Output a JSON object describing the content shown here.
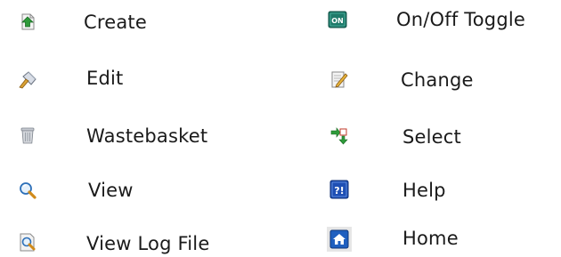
{
  "legend": {
    "left": [
      {
        "label": "Create",
        "icon": "create-icon"
      },
      {
        "label": "Edit",
        "icon": "edit-icon"
      },
      {
        "label": "Wastebasket",
        "icon": "wastebasket-icon"
      },
      {
        "label": "View",
        "icon": "view-icon"
      },
      {
        "label": "View Log File",
        "icon": "view-log-file-icon"
      }
    ],
    "right": [
      {
        "label": "On/Off Toggle",
        "icon": "on-off-toggle-icon",
        "icon_text": "ON"
      },
      {
        "label": "Change",
        "icon": "change-icon"
      },
      {
        "label": "Select",
        "icon": "select-icon"
      },
      {
        "label": "Help",
        "icon": "help-icon",
        "icon_text": "?!"
      },
      {
        "label": "Home",
        "icon": "home-icon"
      }
    ]
  },
  "colors": {
    "green": "#2e8b3a",
    "toggle_teal": "#1f7a6a",
    "help_blue": "#1e4fb4",
    "home_blue": "#1f5fbf"
  }
}
